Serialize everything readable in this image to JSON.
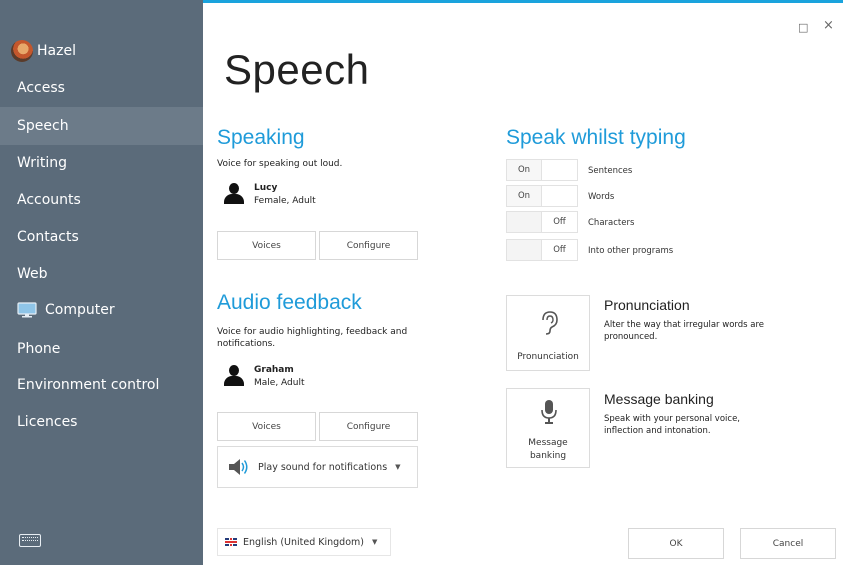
{
  "sidebar": {
    "user": "Hazel",
    "items": [
      "Access",
      "Speech",
      "Writing",
      "Accounts",
      "Contacts",
      "Web",
      "Computer",
      "Phone",
      "Environment control",
      "Licences"
    ],
    "active": "Speech"
  },
  "window": {
    "maximize_glyph": "□",
    "close_glyph": "×"
  },
  "page": {
    "title": "Speech"
  },
  "speaking": {
    "title": "Speaking",
    "description": "Voice for speaking out loud.",
    "voice_name": "Lucy",
    "voice_meta": "Female, Adult",
    "voices_label": "Voices",
    "configure_label": "Configure"
  },
  "audio_feedback": {
    "title": "Audio feedback",
    "description": "Voice for audio highlighting, feedback and notifications.",
    "voice_name": "Graham",
    "voice_meta": "Male, Adult",
    "voices_label": "Voices",
    "configure_label": "Configure",
    "notification_option": "Play sound for notifications"
  },
  "speak_whilst_typing": {
    "title": "Speak whilst typing",
    "toggles": [
      {
        "label": "Sentences",
        "state": "On"
      },
      {
        "label": "Words",
        "state": "On"
      },
      {
        "label": "Characters",
        "state": "Off"
      },
      {
        "label": "Into other programs",
        "state": "Off"
      }
    ]
  },
  "pronunciation": {
    "tile_label": "Pronunciation",
    "title": "Pronunciation",
    "description": "Alter the way that irregular words are pronounced."
  },
  "message_banking": {
    "tile_label": "Message banking",
    "title": "Message banking",
    "description": "Speak with your personal voice, inflection and intonation."
  },
  "footer": {
    "language": "English (United Kingdom)",
    "ok_label": "OK",
    "cancel_label": "Cancel"
  },
  "colors": {
    "sidebar": "#5b6b7a",
    "active_item": "#6c7b89",
    "accent": "#1f9bd9"
  },
  "icons": [
    "avatar",
    "monitor-icon",
    "person-icon",
    "speaker-icon",
    "ear-icon",
    "microphone-icon",
    "uk-flag-icon",
    "keyboard-icon",
    "chevron-down-icon"
  ]
}
